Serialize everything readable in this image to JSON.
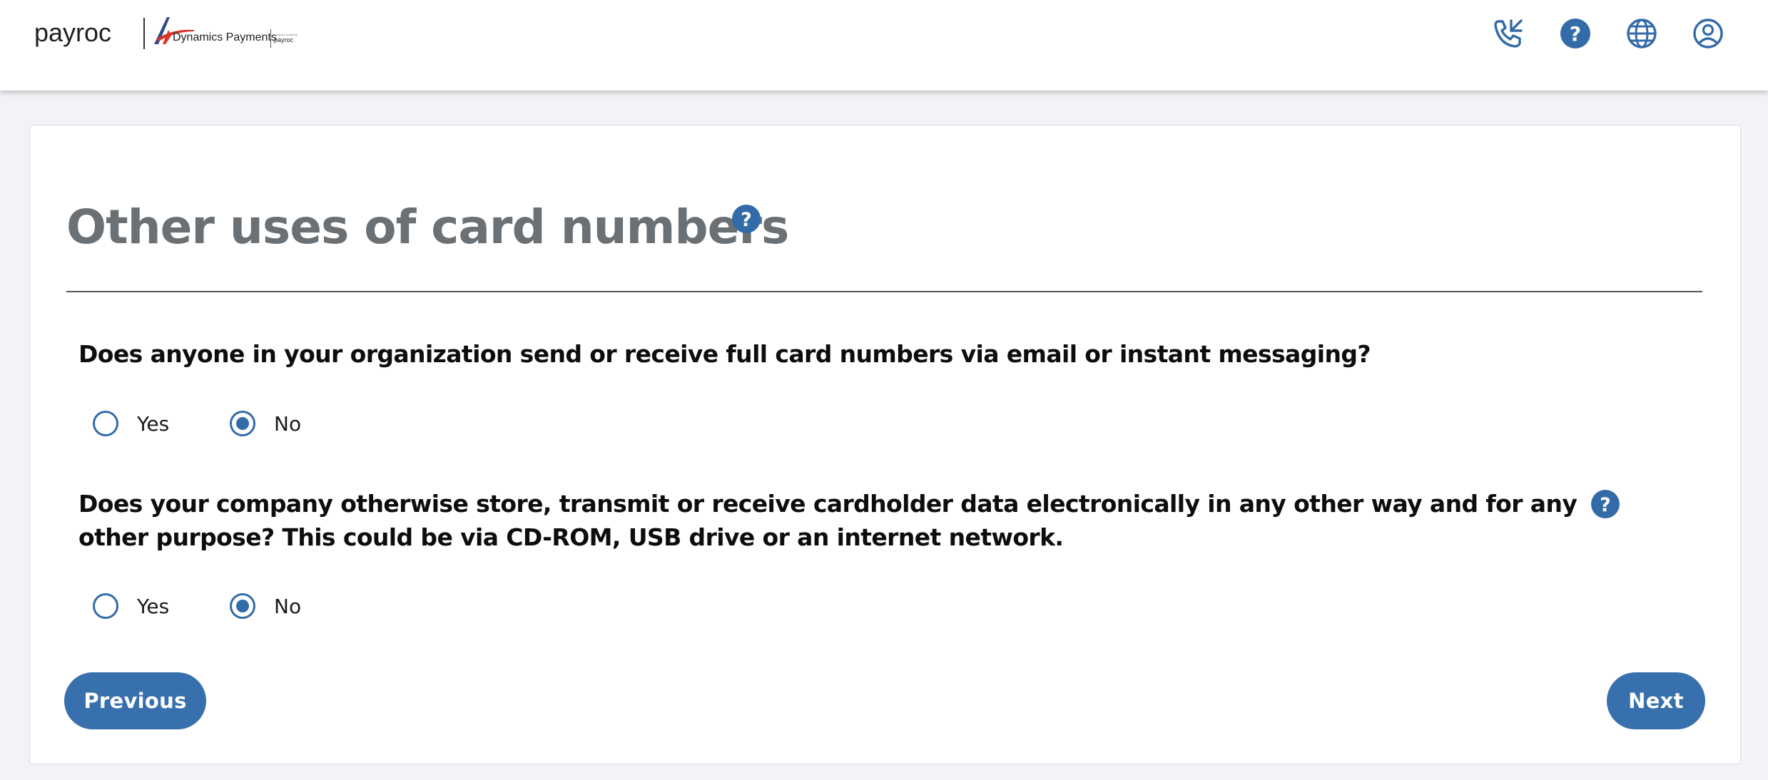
{
  "header": {
    "brand_name": "payroc",
    "partner_name": "Dynamics Payments",
    "partner_subtext": "a payroc company",
    "partner_subbrand": "payroc",
    "icons": [
      {
        "name": "phone-icon",
        "label": "Contact"
      },
      {
        "name": "help-icon",
        "label": "Help"
      },
      {
        "name": "globe-icon",
        "label": "Language"
      },
      {
        "name": "account-icon",
        "label": "Account"
      }
    ]
  },
  "page": {
    "title": "Other uses of card numbers"
  },
  "questions": [
    {
      "text": "Does anyone in your organization send or receive full card numbers via email or instant messaging?",
      "options": [
        "Yes",
        "No"
      ],
      "selected": "No",
      "has_help": false
    },
    {
      "text": "Does your company otherwise store, transmit or receive cardholder data electronically in any other way and for any other purpose? This could be via CD-ROM, USB drive or an internet network.",
      "options": [
        "Yes",
        "No"
      ],
      "selected": "No",
      "has_help": true
    }
  ],
  "navigation": {
    "previous_label": "Previous",
    "next_label": "Next"
  },
  "colors": {
    "accent": "#3770ac",
    "title": "#6b7074",
    "page_bg": "#f1f3f6"
  }
}
